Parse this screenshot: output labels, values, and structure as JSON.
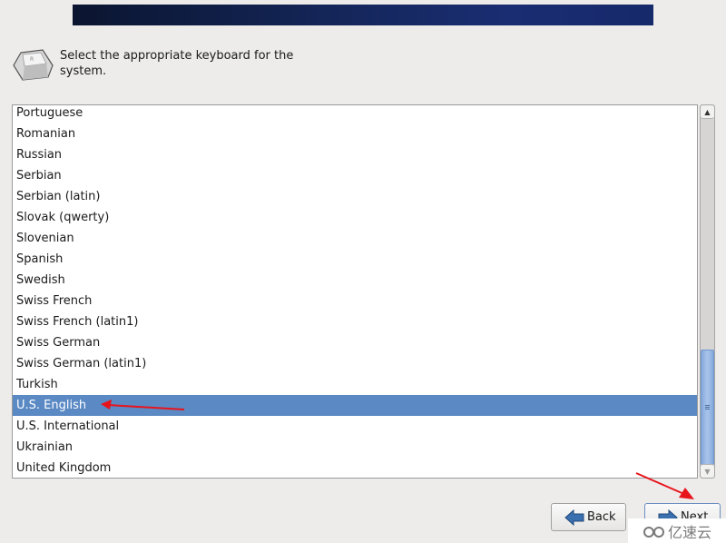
{
  "header": {
    "prompt": "Select the appropriate keyboard for the system.",
    "icon": "keyboard-key-icon"
  },
  "keyboard_list": {
    "items": [
      {
        "label": "Portuguese"
      },
      {
        "label": "Romanian"
      },
      {
        "label": "Russian"
      },
      {
        "label": "Serbian"
      },
      {
        "label": "Serbian (latin)"
      },
      {
        "label": "Slovak (qwerty)"
      },
      {
        "label": "Slovenian"
      },
      {
        "label": "Spanish"
      },
      {
        "label": "Swedish"
      },
      {
        "label": "Swiss French"
      },
      {
        "label": "Swiss French (latin1)"
      },
      {
        "label": "Swiss German"
      },
      {
        "label": "Swiss German (latin1)"
      },
      {
        "label": "Turkish"
      },
      {
        "label": "U.S. English",
        "selected": true
      },
      {
        "label": "U.S. International"
      },
      {
        "label": "Ukrainian"
      },
      {
        "label": "United Kingdom"
      }
    ],
    "selected": "U.S. English",
    "scroll_position_fraction": 1.0
  },
  "buttons": {
    "back_label": "Back",
    "next_label": "Next"
  },
  "annotations": {
    "arrow_color": "#e8141c"
  },
  "watermark": {
    "text": "亿速云"
  },
  "colors": {
    "banner": "#142659",
    "selection": "#5a89c4",
    "background": "#edeceb"
  }
}
